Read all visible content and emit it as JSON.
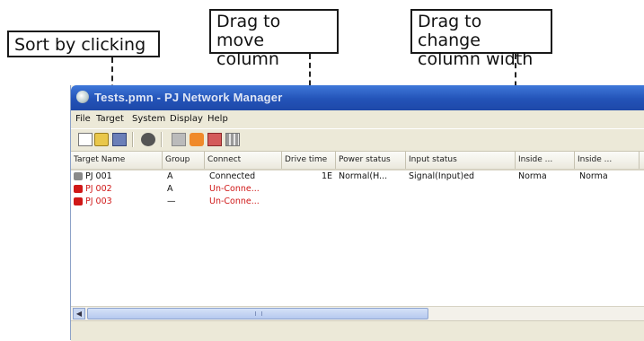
{
  "callouts": {
    "sort": "Sort by clicking",
    "move_line1": "Drag to move",
    "move_line2": "column",
    "width_line1": "Drag to change",
    "width_line2": "column width"
  },
  "window": {
    "title": "Tests.pmn - PJ Network Manager"
  },
  "menu": [
    "File",
    "Target",
    "System",
    "Display",
    "Help"
  ],
  "toolbar_icons": [
    "new-icon",
    "open-icon",
    "save-icon",
    "connect-icon",
    "power-icon",
    "alert-icon",
    "settings-icon",
    "grid-icon"
  ],
  "table": {
    "columns": [
      "Target Name",
      "Group",
      "Connect",
      "Drive time",
      "Power status",
      "Input status",
      "Inside ...",
      "Inside ..."
    ],
    "rows": [
      {
        "cells": [
          "PJ 001",
          "A",
          "Connected",
          "1E",
          "Normal(H...",
          "Signal(Input)ed",
          "Norma",
          "Norma"
        ],
        "status": "ok"
      },
      {
        "cells": [
          "PJ 002",
          "A",
          "Un-Conne...",
          "",
          "",
          "",
          "",
          ""
        ],
        "status": "error"
      },
      {
        "cells": [
          "PJ 003",
          "—",
          "Un-Conne...",
          "",
          "",
          "",
          "",
          ""
        ],
        "status": "error"
      }
    ]
  },
  "colors": {
    "error_text": "#d01818",
    "ok_text": "#111111",
    "titlebar": "#2353b8"
  }
}
